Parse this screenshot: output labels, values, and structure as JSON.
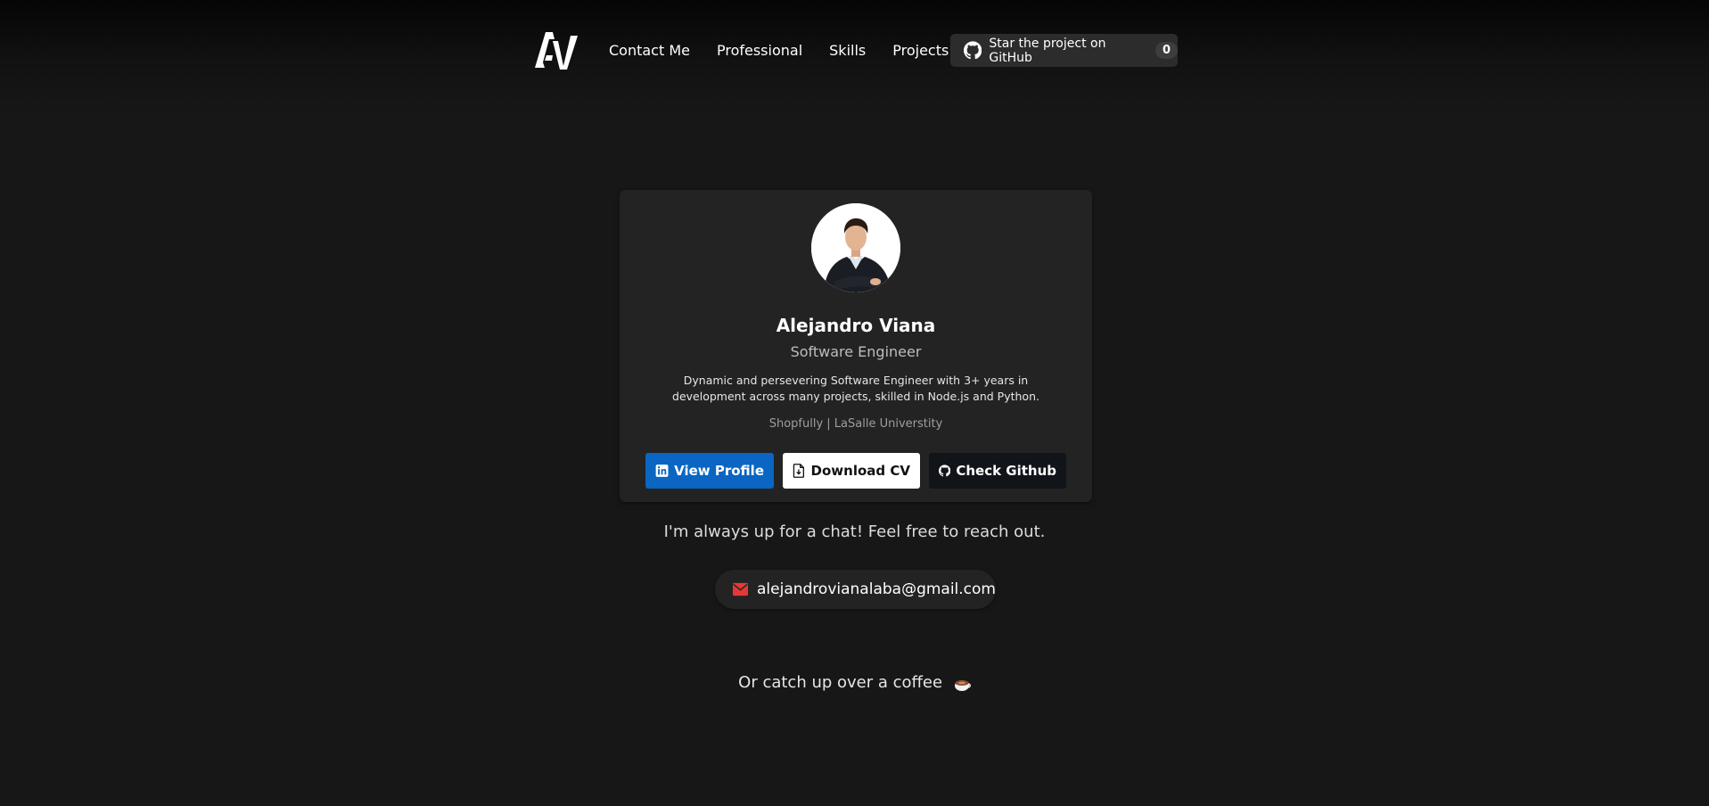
{
  "nav": {
    "logo_alt": "AV",
    "links": [
      "Contact Me",
      "Professional",
      "Skills",
      "Projects"
    ],
    "github_star": {
      "label": "Star the project on GitHub",
      "count": "0",
      "icon": "github-icon"
    }
  },
  "profile": {
    "name": "Alejandro Viana",
    "role": "Software Engineer",
    "bio": "Dynamic and persevering Software Engineer with 3+ years in development across many projects, skilled in Node.js and Python.",
    "orgs": "Shopfully | LaSalle Universtity",
    "buttons": {
      "linkedin": "View Profile",
      "cv": "Download CV",
      "github": "Check Github"
    }
  },
  "contact": {
    "chat_text": "I'm always up for a chat! Feel free to reach out.",
    "email": "alejandrovianalaba@gmail.com",
    "coffee_text": "Or catch up over a coffee"
  },
  "colors": {
    "background": "#171717",
    "card": "#232323",
    "linkedin": "#0a66c2",
    "email_icon": "#e53935"
  }
}
